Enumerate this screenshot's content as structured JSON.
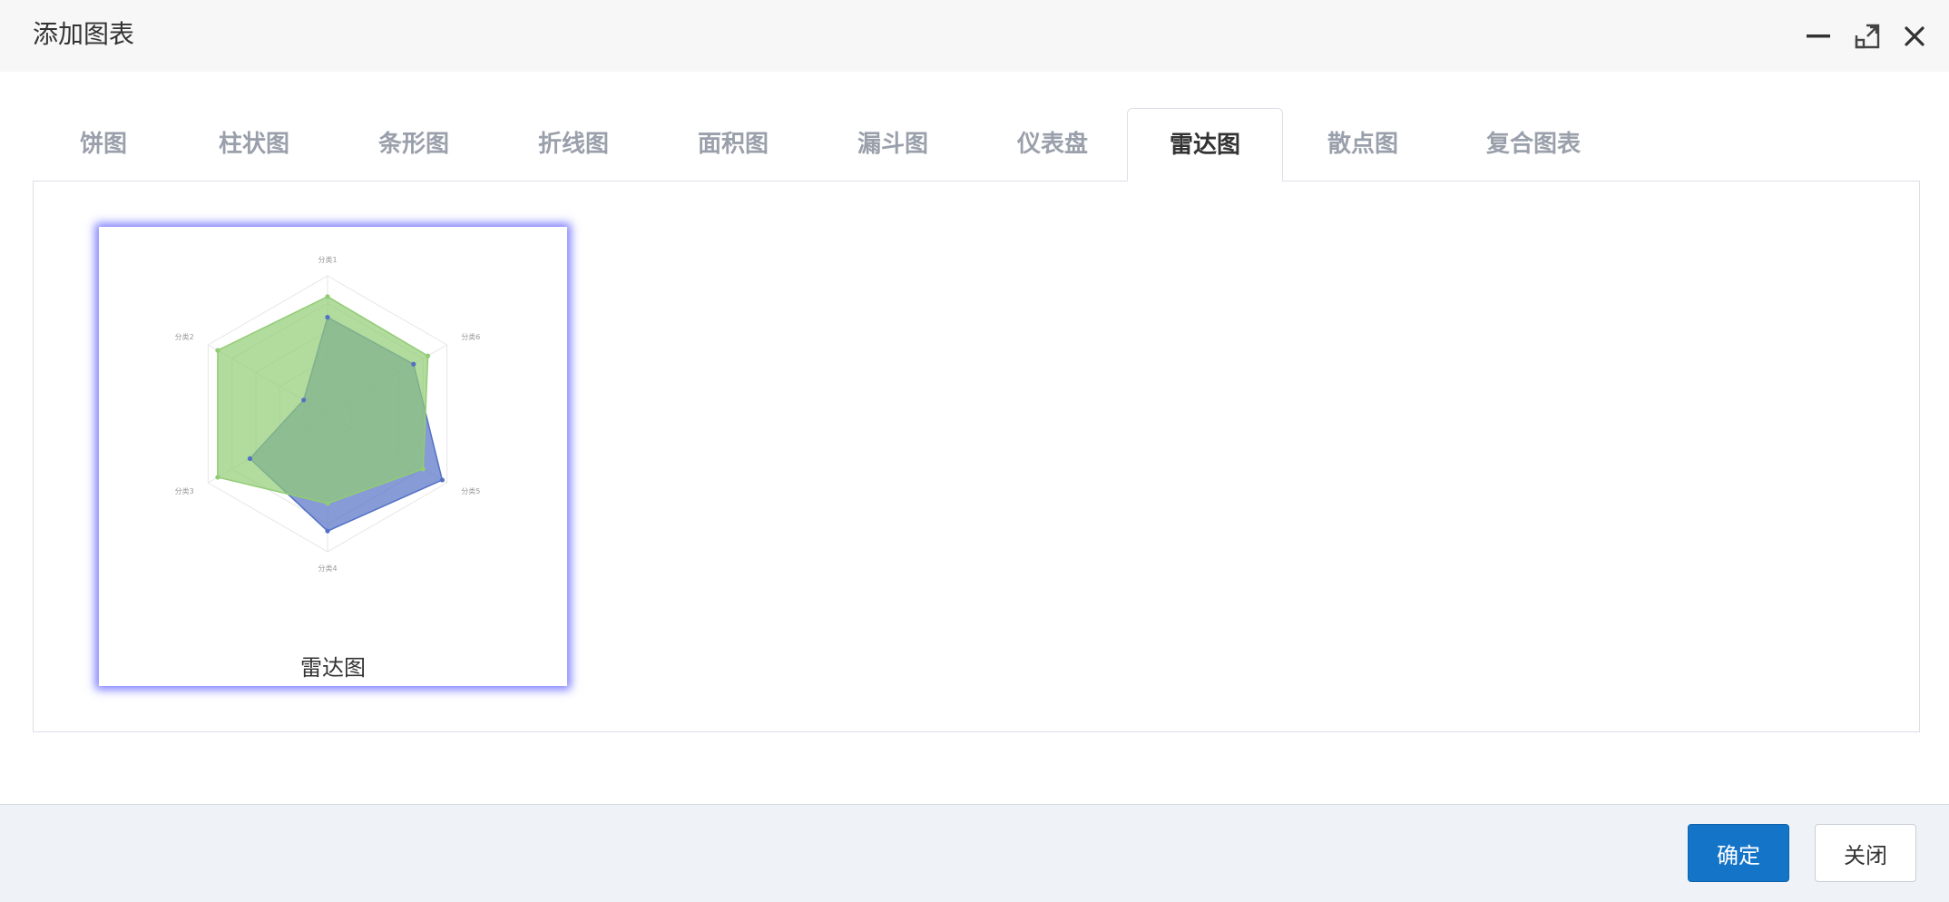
{
  "dialog": {
    "title": "添加图表",
    "controls": {
      "minimize": "minimize-icon",
      "maximize": "maximize-icon",
      "close": "close-icon"
    }
  },
  "tabs": [
    {
      "label": "饼图",
      "active": false
    },
    {
      "label": "柱状图",
      "active": false
    },
    {
      "label": "条形图",
      "active": false
    },
    {
      "label": "折线图",
      "active": false
    },
    {
      "label": "面积图",
      "active": false
    },
    {
      "label": "漏斗图",
      "active": false
    },
    {
      "label": "仪表盘",
      "active": false
    },
    {
      "label": "雷达图",
      "active": true
    },
    {
      "label": "散点图",
      "active": false
    },
    {
      "label": "复合图表",
      "active": false
    }
  ],
  "cards": [
    {
      "label": "雷达图",
      "selected": true
    }
  ],
  "chart_data": {
    "type": "radar",
    "indicators": [
      "分类1",
      "分类6",
      "分类5",
      "分类4",
      "分类3",
      "分类2"
    ],
    "max": 100,
    "series": [
      {
        "color": "#5470c6",
        "values": [
          70,
          72,
          96,
          85,
          65,
          20
        ]
      },
      {
        "color": "#91cc75",
        "values": [
          85,
          84,
          80,
          65,
          92,
          92
        ]
      }
    ]
  },
  "footer": {
    "confirm_label": "确定",
    "close_label": "关闭"
  },
  "colors": {
    "primary": "#1474c8",
    "selection_glow": "#7d7dff",
    "tab_inactive": "#9aa0ab"
  }
}
